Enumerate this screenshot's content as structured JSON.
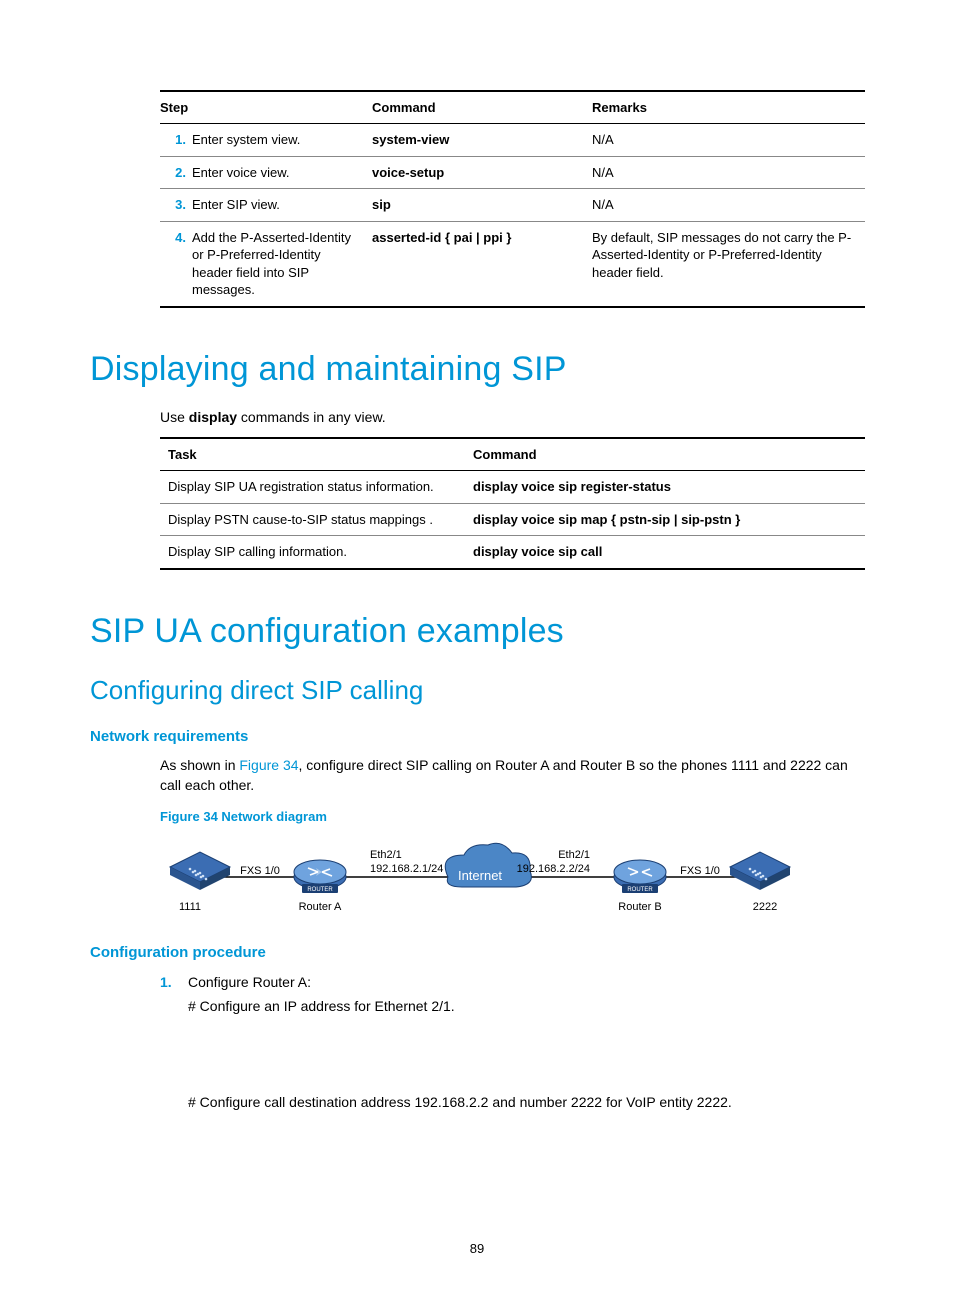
{
  "table1": {
    "headers": [
      "Step",
      "Command",
      "Remarks"
    ],
    "rows": [
      {
        "num": "1.",
        "desc": "Enter system view.",
        "cmd": "system-view",
        "remarks": "N/A"
      },
      {
        "num": "2.",
        "desc": "Enter voice view.",
        "cmd": "voice-setup",
        "remarks": "N/A"
      },
      {
        "num": "3.",
        "desc": "Enter SIP view.",
        "cmd": "sip",
        "remarks": "N/A"
      },
      {
        "num": "4.",
        "desc": "Add the P-Asserted-Identity or P-Preferred-Identity header field into SIP messages.",
        "cmd_pre": "asserted-id",
        "cmd_arg": " { pai | ppi }",
        "remarks": "By default, SIP messages do not carry the P-Asserted-Identity or P-Preferred-Identity header field."
      }
    ]
  },
  "h1_a": "Displaying and maintaining SIP",
  "p_use_pre": "Use ",
  "p_use_bold": "display",
  "p_use_post": " commands in any view.",
  "table2": {
    "headers": [
      "Task",
      "Command"
    ],
    "rows": [
      {
        "task": "Display SIP UA registration status information.",
        "cmd": "display voice sip register-status"
      },
      {
        "task": "Display PSTN cause-to-SIP status mappings .",
        "cmd_pre": "display voice sip map",
        "cmd_arg": " { pstn-sip | sip-pstn }"
      },
      {
        "task": "Display SIP calling information.",
        "cmd": "display voice sip call"
      }
    ]
  },
  "h1_b": "SIP UA configuration examples",
  "h2_a": "Configuring direct SIP calling",
  "h3_net": "Network requirements",
  "p_net_pre": "As shown in ",
  "p_net_link": "Figure 34",
  "p_net_post": ", configure direct SIP calling on Router A and Router B so the phones 1111 and 2222 can call each other.",
  "fig_caption": "Figure 34 Network diagram",
  "diagram": {
    "phoneA": "1111",
    "fxsA": "FXS 1/0",
    "routerA": "Router A",
    "ethA": "Eth2/1",
    "ipA": "192.168.2.1/24",
    "internet": "Internet",
    "ethB": "Eth2/1",
    "ipB": "192.168.2.2/24",
    "routerB": "Router B",
    "fxsB": "FXS 1/0",
    "phoneB": "2222",
    "router_label": "ROUTER"
  },
  "h3_proc": "Configuration procedure",
  "proc": {
    "num": "1.",
    "line1": "Configure Router A:",
    "line2": "# Configure an IP address for Ethernet 2/1.",
    "line3": "# Configure call destination address 192.168.2.2 and number 2222 for VoIP entity 2222."
  },
  "page_number": "89"
}
